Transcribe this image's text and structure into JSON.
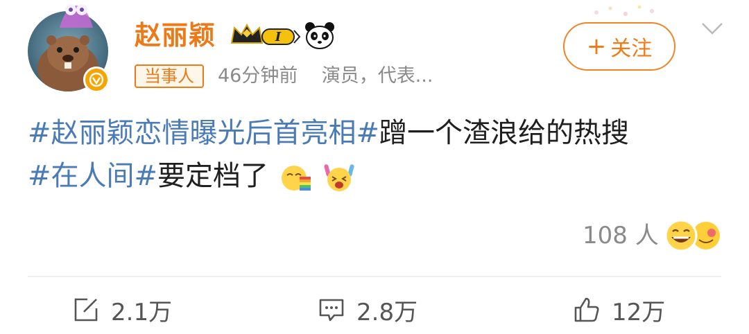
{
  "user": {
    "name": "赵丽颖",
    "level_badge": "I",
    "tag": "当事人",
    "time": "46分钟前",
    "description": "演员，代表..."
  },
  "follow": {
    "label": "关注",
    "plus": "+"
  },
  "post": {
    "line1": [
      {
        "text": "#赵丽颖恋情曝光后首亮相#",
        "hashtag": true
      },
      {
        "text": "蹭一个渣浪给的热搜",
        "hashtag": false
      }
    ],
    "line2": [
      {
        "text": "#在人间#",
        "hashtag": true
      },
      {
        "text": "要定档了",
        "hashtag": false
      }
    ],
    "emojis": [
      "rainbow-vomit-emoji",
      "excited-glowsticks-emoji"
    ]
  },
  "reactions": {
    "count_text": "108 人",
    "emojis": [
      "grin-emoji",
      "hug-emoji"
    ]
  },
  "actions": {
    "repost": {
      "icon": "share-icon",
      "count": "2.1万"
    },
    "comment": {
      "icon": "comment-icon",
      "count": "2.8万"
    },
    "like": {
      "icon": "thumbs-up-icon",
      "count": "12万"
    }
  },
  "colors": {
    "accent": "#ec7a18",
    "hashtag": "#4a7bb6",
    "muted": "#8a8a8a"
  }
}
